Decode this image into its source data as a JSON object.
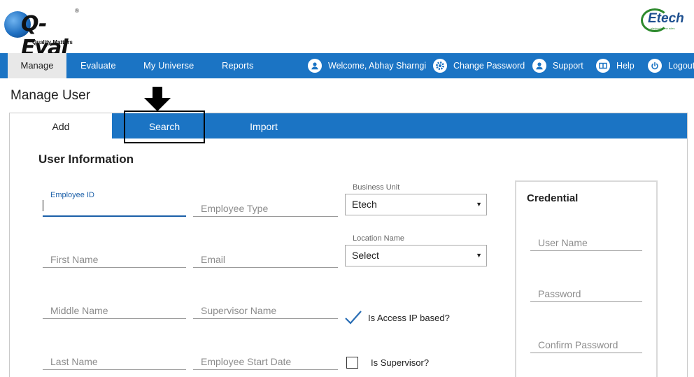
{
  "brand": {
    "logo_text": "Q-Eval",
    "tagline": "Quality Matters",
    "partner_logo_text": "Etech",
    "partner_slogan": "playing by the rules"
  },
  "nav": {
    "items": [
      {
        "label": "Manage",
        "active": true
      },
      {
        "label": "Evaluate"
      },
      {
        "label": "My Universe"
      },
      {
        "label": "Reports"
      }
    ],
    "welcome": "Welcome, Abhay Sharngi",
    "change_password": "Change Password",
    "support": "Support",
    "help": "Help",
    "logout": "Logout"
  },
  "page": {
    "title": "Manage User"
  },
  "tabs": [
    {
      "label": "Add",
      "active": true
    },
    {
      "label": "Search"
    },
    {
      "label": "Import"
    }
  ],
  "form": {
    "section_title": "User Information",
    "employee_id": {
      "label": "Employee ID",
      "value": ""
    },
    "employee_type": {
      "placeholder": "Employee Type"
    },
    "first_name": {
      "placeholder": "First Name"
    },
    "email": {
      "placeholder": "Email"
    },
    "middle_name": {
      "placeholder": "Middle Name"
    },
    "supervisor_name": {
      "placeholder": "Supervisor Name"
    },
    "last_name": {
      "placeholder": "Last Name"
    },
    "employee_start_date": {
      "placeholder": "Employee Start Date"
    },
    "business_unit": {
      "label": "Business Unit",
      "value": "Etech"
    },
    "location_name": {
      "label": "Location Name",
      "value": "Select"
    },
    "is_access_ip_based": {
      "label": "Is Access IP based?",
      "checked": true
    },
    "is_supervisor": {
      "label": "Is Supervisor?",
      "checked": false
    }
  },
  "credential": {
    "title": "Credential",
    "user_name": {
      "placeholder": "User Name"
    },
    "password": {
      "placeholder": "Password"
    },
    "confirm_password": {
      "placeholder": "Confirm Password"
    }
  },
  "colors": {
    "primary": "#1b74c4",
    "focus": "#1b5fa8",
    "nav_active_bg": "#e8e8e8"
  }
}
